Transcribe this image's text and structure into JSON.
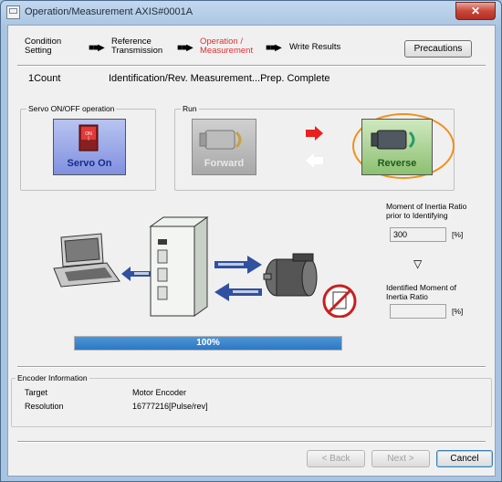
{
  "window": {
    "title": "Operation/Measurement AXIS#0001A",
    "close_label": "✕"
  },
  "steps": [
    {
      "label": "Condition\nSetting"
    },
    {
      "label": "Reference\nTransmission"
    },
    {
      "label": "Operation /\nMeasurement"
    },
    {
      "label": "Write Results"
    }
  ],
  "step_arrow": "■■▶",
  "precautions_label": "Precautions",
  "status": {
    "count": "1Count",
    "message": "Identification/Rev. Measurement...Prep. Complete"
  },
  "servo_group": {
    "label": "Servo ON/OFF operation",
    "button_label": "Servo On",
    "switch_text": "ON\n|"
  },
  "run_group": {
    "label": "Run",
    "forward_label": "Forward",
    "reverse_label": "Reverse"
  },
  "inertia": {
    "ratio_label": "Moment of Inertia Ratio\nprior to Identifying",
    "ratio_value": "300",
    "ratio_unit": "[%]",
    "identified_label": "Identified Moment of\nInertia Ratio",
    "identified_value": "",
    "identified_unit": "[%]",
    "down_arrow": "▽"
  },
  "progress": {
    "value": 1.0,
    "label": "100%"
  },
  "encoder": {
    "group_label": "Encoder Information",
    "target_label": "Target",
    "target_value": "Motor Encoder",
    "resolution_label": "Resolution",
    "resolution_value": "16777216[Pulse/rev]"
  },
  "buttons": {
    "back": "< Back",
    "next": "Next >",
    "cancel": "Cancel"
  },
  "colors": {
    "accent_red": "#e03030",
    "progress_blue": "#3a86cc",
    "reverse_green": "#5a9a3a",
    "servo_blue": "#3a4fb0"
  }
}
